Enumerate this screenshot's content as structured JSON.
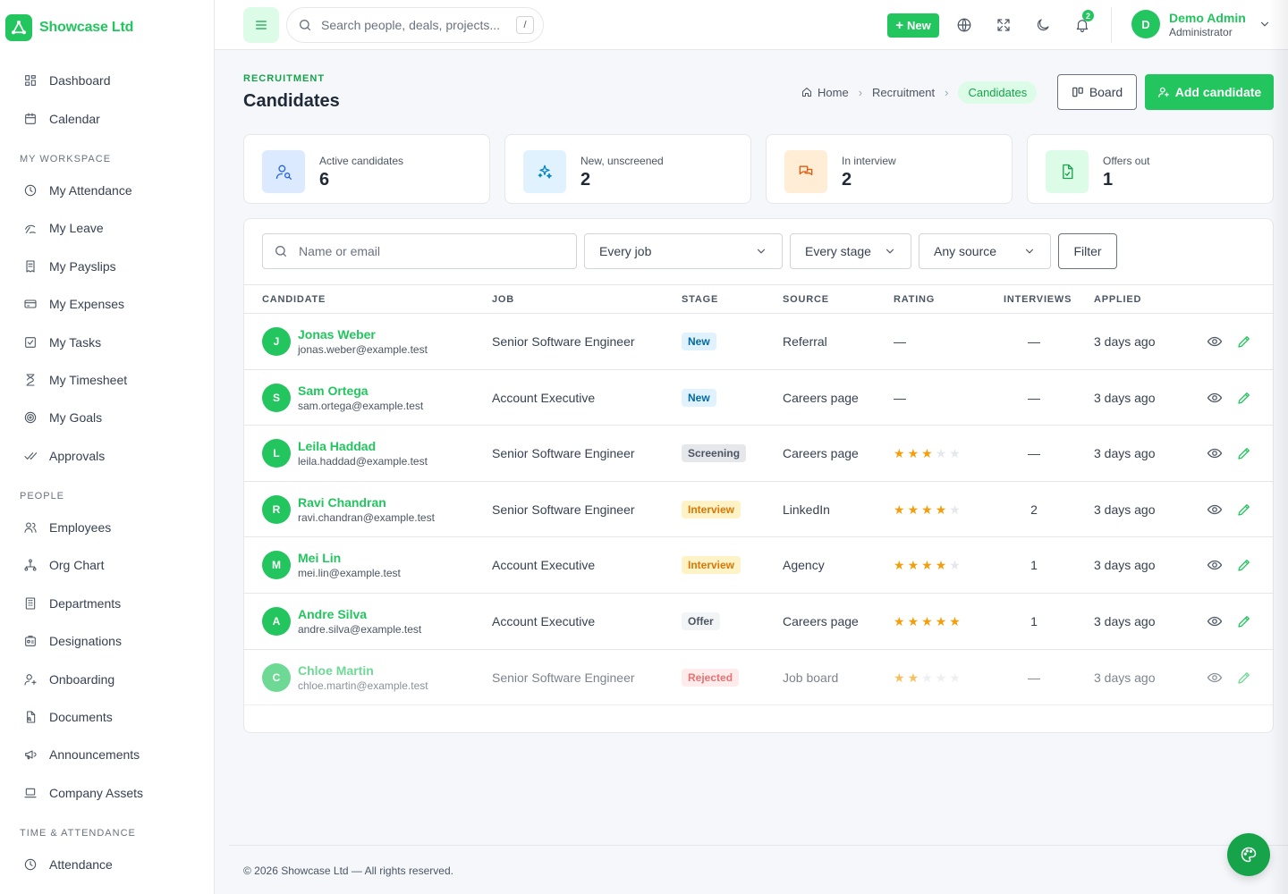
{
  "brand": {
    "name": "Showcase Ltd",
    "color": "#22c55e"
  },
  "sidebar": {
    "top": [
      {
        "label": "Dashboard",
        "icon": "dashboard-icon"
      },
      {
        "label": "Calendar",
        "icon": "calendar-icon"
      }
    ],
    "sections": [
      {
        "title": "MY WORKSPACE",
        "items": [
          {
            "label": "My Attendance",
            "icon": "clock-icon"
          },
          {
            "label": "My Leave",
            "icon": "umbrella-icon"
          },
          {
            "label": "My Payslips",
            "icon": "receipt-icon"
          },
          {
            "label": "My Expenses",
            "icon": "credit-card-icon"
          },
          {
            "label": "My Tasks",
            "icon": "checkbox-icon"
          },
          {
            "label": "My Timesheet",
            "icon": "hourglass-icon"
          },
          {
            "label": "My Goals",
            "icon": "target-icon"
          },
          {
            "label": "Approvals",
            "icon": "double-check-icon"
          }
        ]
      },
      {
        "title": "PEOPLE",
        "items": [
          {
            "label": "Employees",
            "icon": "users-icon"
          },
          {
            "label": "Org Chart",
            "icon": "sitemap-icon"
          },
          {
            "label": "Departments",
            "icon": "building-icon"
          },
          {
            "label": "Designations",
            "icon": "id-badge-icon"
          },
          {
            "label": "Onboarding",
            "icon": "user-plus-icon"
          },
          {
            "label": "Documents",
            "icon": "document-icon"
          },
          {
            "label": "Announcements",
            "icon": "megaphone-icon"
          },
          {
            "label": "Company Assets",
            "icon": "laptop-icon"
          }
        ]
      },
      {
        "title": "TIME & ATTENDANCE",
        "items": [
          {
            "label": "Attendance",
            "icon": "clock-icon"
          }
        ]
      }
    ]
  },
  "topbar": {
    "search_placeholder": "Search people, deals, projects...",
    "search_shortcut": "/",
    "new_label": "New",
    "notification_count": "2",
    "user": {
      "initial": "D",
      "name": "Demo Admin",
      "role": "Administrator"
    }
  },
  "header": {
    "eyebrow": "RECRUITMENT",
    "title": "Candidates",
    "breadcrumb": [
      "Home",
      "Recruitment",
      "Candidates"
    ],
    "board_label": "Board",
    "add_label": "Add candidate"
  },
  "stats": [
    {
      "label": "Active candidates",
      "value": "6",
      "icon": "user-search-icon",
      "bg": "#dbeafe",
      "fg": "#2563eb"
    },
    {
      "label": "New, unscreened",
      "value": "2",
      "icon": "sparkles-icon",
      "bg": "#e0f2fe",
      "fg": "#0284c7"
    },
    {
      "label": "In interview",
      "value": "2",
      "icon": "chat-bubbles-icon",
      "bg": "#ffedd5",
      "fg": "#ea580c"
    },
    {
      "label": "Offers out",
      "value": "1",
      "icon": "file-check-icon",
      "bg": "#dcfce7",
      "fg": "#16a34a"
    }
  ],
  "filters": {
    "search_placeholder": "Name or email",
    "job": "Every job",
    "stage": "Every stage",
    "source": "Any source",
    "filter_label": "Filter"
  },
  "table": {
    "columns": [
      "CANDIDATE",
      "JOB",
      "STAGE",
      "SOURCE",
      "RATING",
      "INTERVIEWS",
      "APPLIED"
    ],
    "rows": [
      {
        "initial": "J",
        "name": "Jonas Weber",
        "email": "jonas.weber@example.test",
        "job": "Senior Software Engineer",
        "stage": "New",
        "stage_style": "new",
        "source": "Referral",
        "rating": 0,
        "rating_text": "—",
        "interviews": "—",
        "applied": "3 days ago",
        "dim": false
      },
      {
        "initial": "S",
        "name": "Sam Ortega",
        "email": "sam.ortega@example.test",
        "job": "Account Executive",
        "stage": "New",
        "stage_style": "new",
        "source": "Careers page",
        "rating": 0,
        "rating_text": "—",
        "interviews": "—",
        "applied": "3 days ago",
        "dim": false
      },
      {
        "initial": "L",
        "name": "Leila Haddad",
        "email": "leila.haddad@example.test",
        "job": "Senior Software Engineer",
        "stage": "Screening",
        "stage_style": "screening",
        "source": "Careers page",
        "rating": 3,
        "rating_text": "",
        "interviews": "—",
        "applied": "3 days ago",
        "dim": false
      },
      {
        "initial": "R",
        "name": "Ravi Chandran",
        "email": "ravi.chandran@example.test",
        "job": "Senior Software Engineer",
        "stage": "Interview",
        "stage_style": "interview",
        "source": "LinkedIn",
        "rating": 4,
        "rating_text": "",
        "interviews": "2",
        "applied": "3 days ago",
        "dim": false
      },
      {
        "initial": "M",
        "name": "Mei Lin",
        "email": "mei.lin@example.test",
        "job": "Account Executive",
        "stage": "Interview",
        "stage_style": "interview",
        "source": "Agency",
        "rating": 4,
        "rating_text": "",
        "interviews": "1",
        "applied": "3 days ago",
        "dim": false
      },
      {
        "initial": "A",
        "name": "Andre Silva",
        "email": "andre.silva@example.test",
        "job": "Account Executive",
        "stage": "Offer",
        "stage_style": "offer",
        "source": "Careers page",
        "rating": 5,
        "rating_text": "",
        "interviews": "1",
        "applied": "3 days ago",
        "dim": false
      },
      {
        "initial": "C",
        "name": "Chloe Martin",
        "email": "chloe.martin@example.test",
        "job": "Senior Software Engineer",
        "stage": "Rejected",
        "stage_style": "rejected",
        "source": "Job board",
        "rating": 2,
        "rating_text": "",
        "interviews": "—",
        "applied": "3 days ago",
        "dim": true
      }
    ]
  },
  "footer": {
    "text": "© 2026 Showcase Ltd — All rights reserved."
  }
}
